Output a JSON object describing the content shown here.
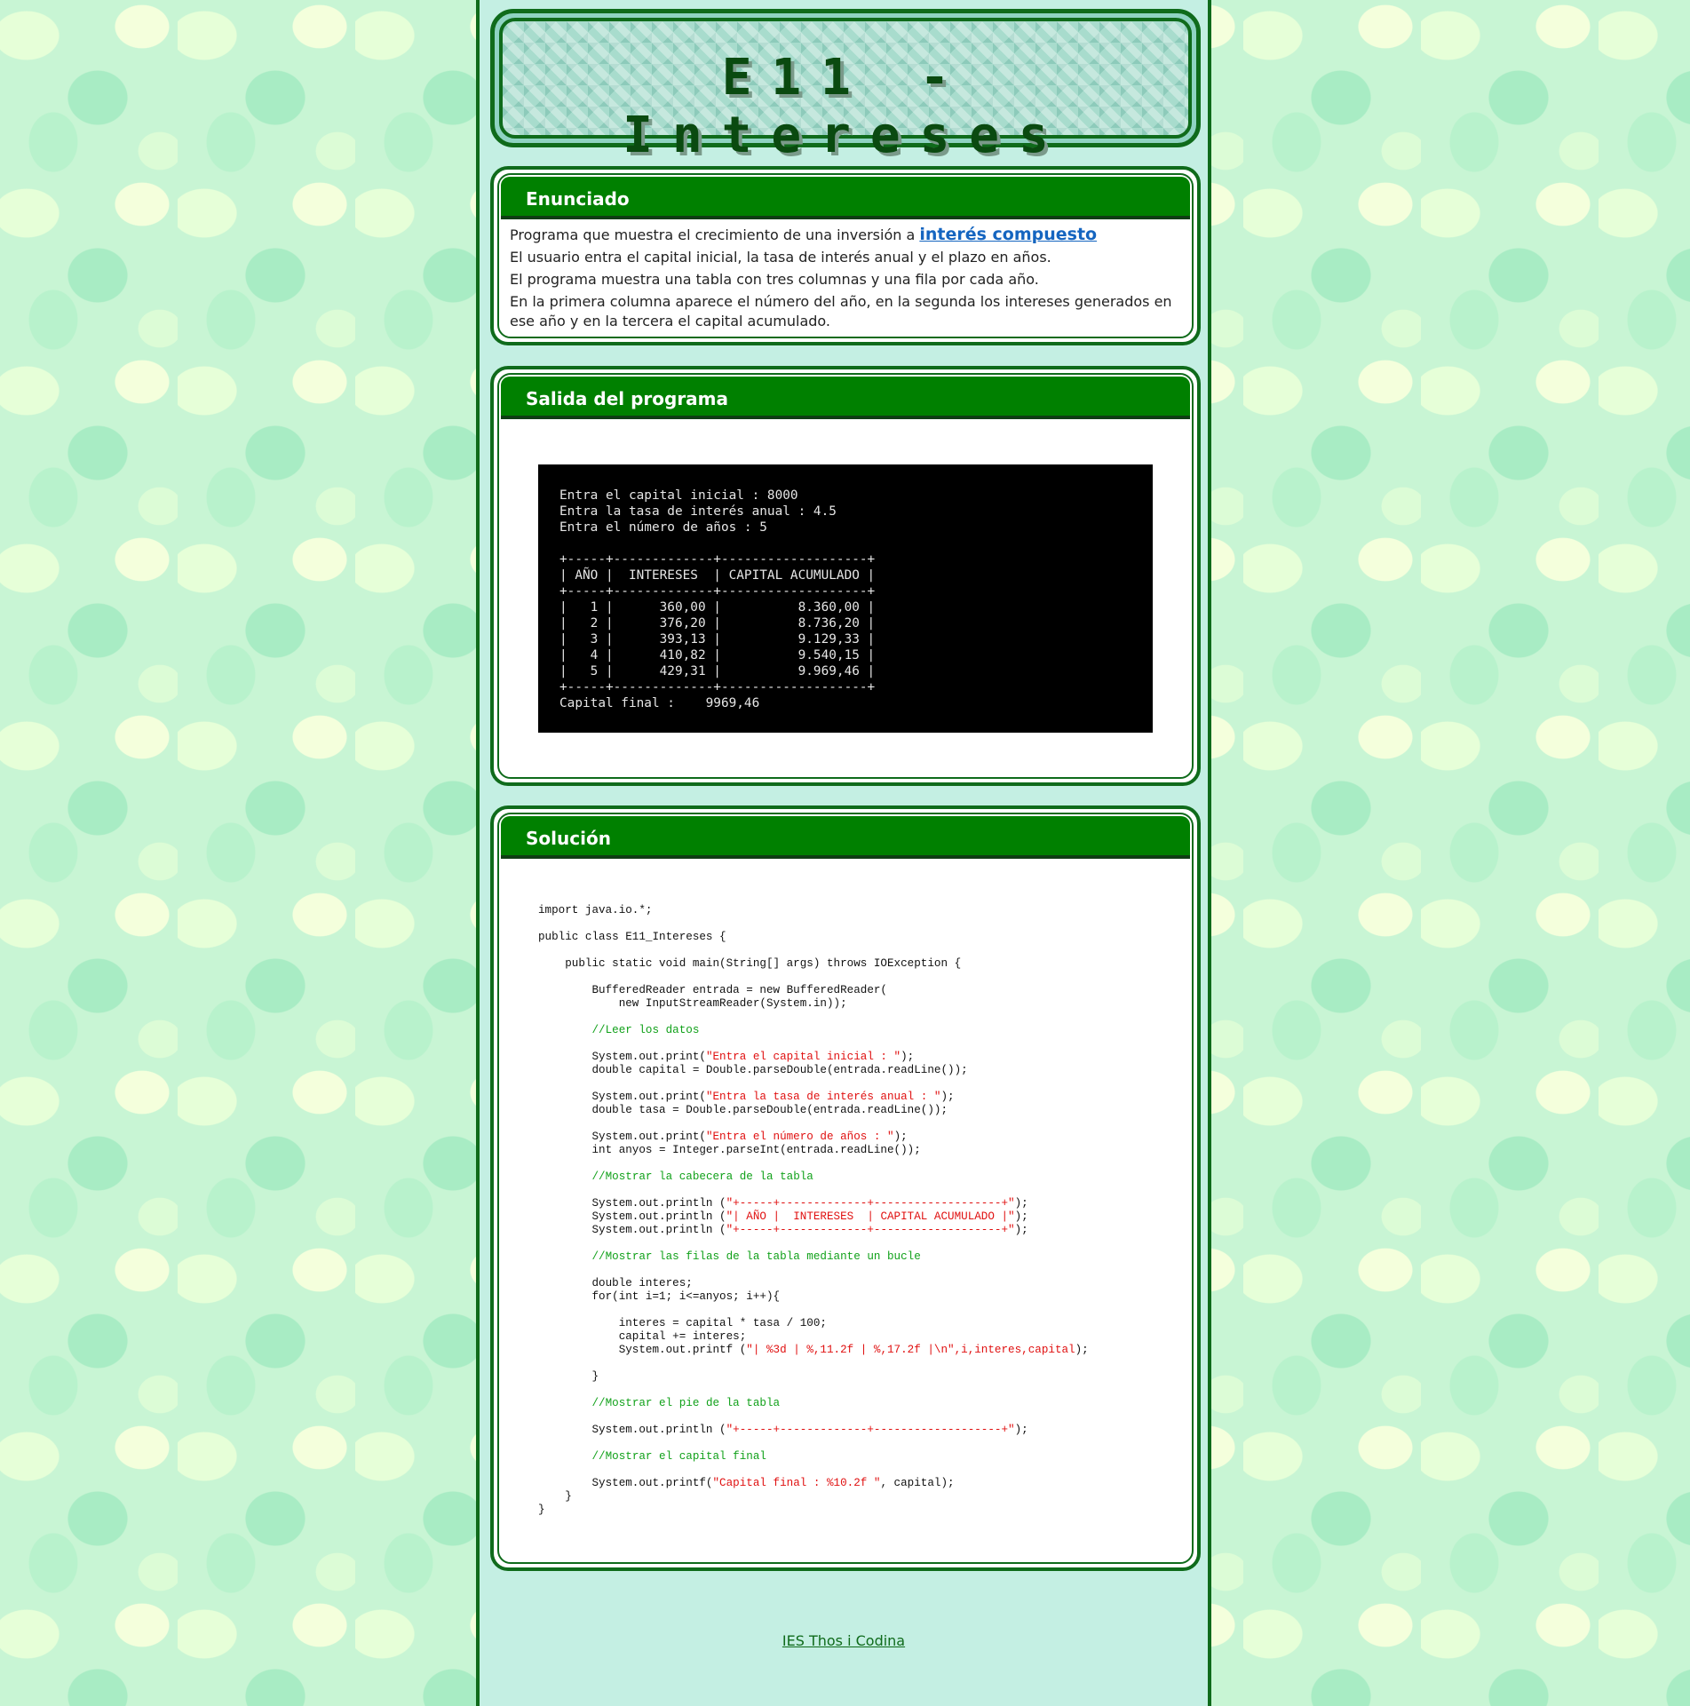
{
  "banner": {
    "title": "E11 - Intereses"
  },
  "enunciado": {
    "heading": "Enunciado",
    "line1_prefix": "Programa que muestra el crecimiento de una inversión a ",
    "line1_link": "interés compuesto",
    "line2": "El usuario entra el capital inicial, la tasa de interés anual y el plazo en años.",
    "line3": "El programa muestra una tabla con tres columnas y una fila por cada año.",
    "line4": "En la primera columna aparece el número del año, en la segunda los intereses generados en ese año y en la tercera el capital acumulado."
  },
  "salida": {
    "heading": "Salida del programa",
    "console_lines": [
      "Entra el capital inicial : 8000",
      "Entra la tasa de interés anual : 4.5",
      "Entra el número de años : 5",
      "",
      "+-----+-------------+-------------------+",
      "| AÑO |  INTERESES  | CAPITAL ACUMULADO |",
      "+-----+-------------+-------------------+",
      "|   1 |      360,00 |          8.360,00 |",
      "|   2 |      376,20 |          8.736,20 |",
      "|   3 |      393,13 |          9.129,33 |",
      "|   4 |      410,82 |          9.540,15 |",
      "|   5 |      429,31 |          9.969,46 |",
      "+-----+-------------+-------------------+",
      "Capital final :    9969,46"
    ]
  },
  "solucion": {
    "heading": "Solución",
    "code_lines": [
      [
        [
          "",
          "import java.io.*;"
        ]
      ],
      [
        [
          "",
          ""
        ]
      ],
      [
        [
          "",
          "public class E11_Intereses {"
        ]
      ],
      [
        [
          "",
          ""
        ]
      ],
      [
        [
          "",
          "    public static void main(String[] args) throws IOException {"
        ]
      ],
      [
        [
          "",
          ""
        ]
      ],
      [
        [
          "",
          "        BufferedReader entrada = new BufferedReader("
        ]
      ],
      [
        [
          "",
          "            new InputStreamReader(System.in));"
        ]
      ],
      [
        [
          "",
          ""
        ]
      ],
      [
        [
          "",
          "        "
        ],
        [
          "c",
          "//Leer los datos"
        ]
      ],
      [
        [
          "",
          ""
        ]
      ],
      [
        [
          "",
          "        System.out.print("
        ],
        [
          "s",
          "\"Entra el capital inicial : \""
        ],
        [
          "",
          ");"
        ]
      ],
      [
        [
          "",
          "        double capital = Double.parseDouble(entrada.readLine());"
        ]
      ],
      [
        [
          "",
          ""
        ]
      ],
      [
        [
          "",
          "        System.out.print("
        ],
        [
          "s",
          "\"Entra la tasa de interés anual : \""
        ],
        [
          "",
          ");"
        ]
      ],
      [
        [
          "",
          "        double tasa = Double.parseDouble(entrada.readLine());"
        ]
      ],
      [
        [
          "",
          ""
        ]
      ],
      [
        [
          "",
          "        System.out.print("
        ],
        [
          "s",
          "\"Entra el número de años : \""
        ],
        [
          "",
          ");"
        ]
      ],
      [
        [
          "",
          "        int anyos = Integer.parseInt(entrada.readLine());"
        ]
      ],
      [
        [
          "",
          ""
        ]
      ],
      [
        [
          "",
          "        "
        ],
        [
          "c",
          "//Mostrar la cabecera de la tabla"
        ]
      ],
      [
        [
          "",
          ""
        ]
      ],
      [
        [
          "",
          "        System.out.println ("
        ],
        [
          "s",
          "\"+-----+-------------+-------------------+\""
        ],
        [
          "",
          ");"
        ]
      ],
      [
        [
          "",
          "        System.out.println ("
        ],
        [
          "s",
          "\"| AÑO |  INTERESES  | CAPITAL ACUMULADO |\""
        ],
        [
          "",
          ");"
        ]
      ],
      [
        [
          "",
          "        System.out.println ("
        ],
        [
          "s",
          "\"+-----+-------------+-------------------+\""
        ],
        [
          "",
          ");"
        ]
      ],
      [
        [
          "",
          ""
        ]
      ],
      [
        [
          "",
          "        "
        ],
        [
          "c",
          "//Mostrar las filas de la tabla mediante un bucle"
        ]
      ],
      [
        [
          "",
          ""
        ]
      ],
      [
        [
          "",
          "        double interes;"
        ]
      ],
      [
        [
          "",
          "        for(int i=1; i<=anyos; i++){"
        ]
      ],
      [
        [
          "",
          ""
        ]
      ],
      [
        [
          "",
          "            interes = capital * tasa / 100;"
        ]
      ],
      [
        [
          "",
          "            capital += interes;"
        ]
      ],
      [
        [
          "",
          "            System.out.printf ("
        ],
        [
          "s",
          "\"| %3d | %,11.2f | %,17.2f |\\n\",i,interes,capital"
        ],
        [
          "",
          ");"
        ]
      ],
      [
        [
          "",
          ""
        ]
      ],
      [
        [
          "",
          "        }"
        ]
      ],
      [
        [
          "",
          ""
        ]
      ],
      [
        [
          "",
          "        "
        ],
        [
          "c",
          "//Mostrar el pie de la tabla"
        ]
      ],
      [
        [
          "",
          ""
        ]
      ],
      [
        [
          "",
          "        System.out.println ("
        ],
        [
          "s",
          "\"+-----+-------------+-------------------+\""
        ],
        [
          "",
          ");"
        ]
      ],
      [
        [
          "",
          ""
        ]
      ],
      [
        [
          "",
          "        "
        ],
        [
          "c",
          "//Mostrar el capital final"
        ]
      ],
      [
        [
          "",
          ""
        ]
      ],
      [
        [
          "",
          "        System.out.printf("
        ],
        [
          "s",
          "\"Capital final : %10.2f \""
        ],
        [
          "",
          ", capital);"
        ]
      ],
      [
        [
          "",
          "    }"
        ]
      ],
      [
        [
          "",
          "}"
        ]
      ]
    ]
  },
  "footer": {
    "link": "IES Thos i Codina"
  }
}
